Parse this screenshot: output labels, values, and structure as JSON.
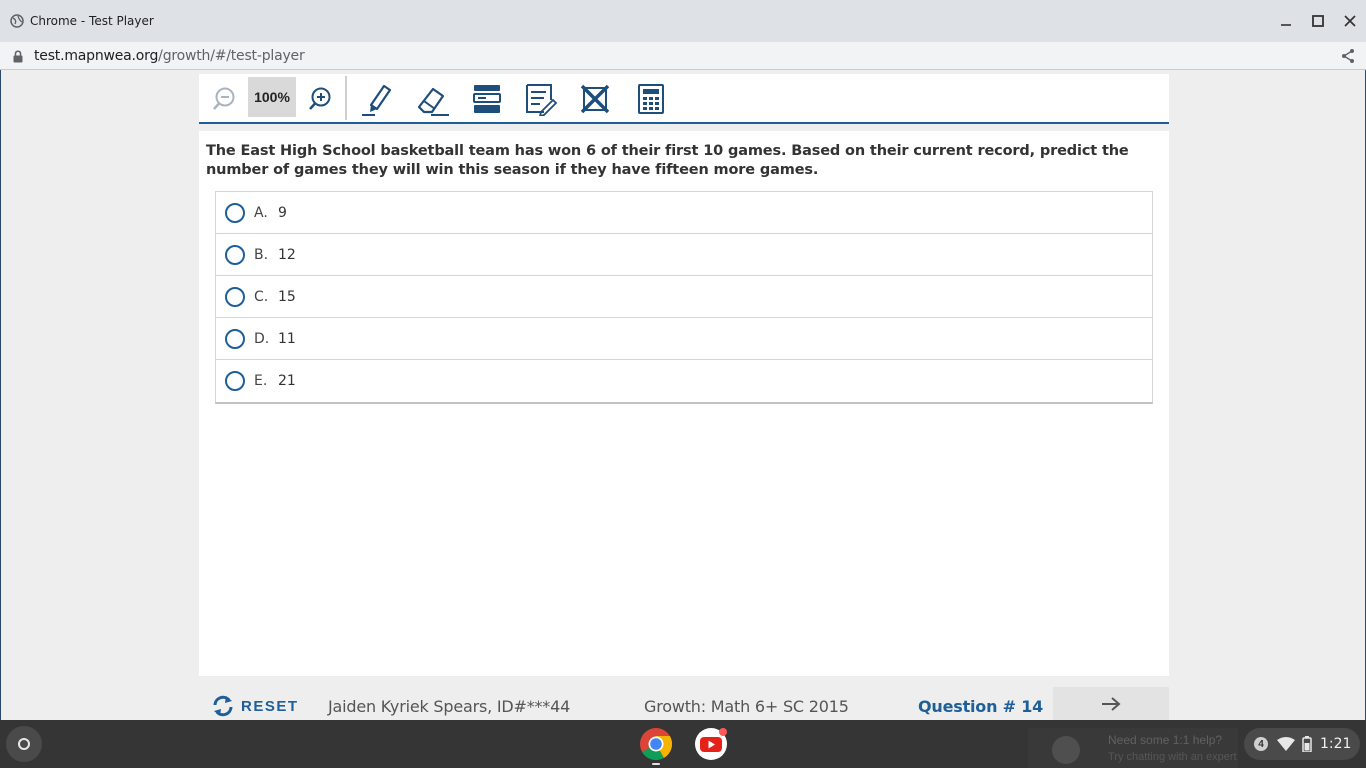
{
  "window": {
    "title": "Chrome - Test Player",
    "url_host": "test.mapnwea.org",
    "url_path": "/growth/#/test-player"
  },
  "toolbar": {
    "zoom_level": "100%",
    "tools": [
      "zoom-out-icon",
      "zoom-in-icon",
      "pen-icon",
      "eraser-icon",
      "line-reader-icon",
      "notepad-icon",
      "answer-eliminator-icon",
      "calculator-icon"
    ]
  },
  "question": {
    "stem": "The East High School basketball team has won 6 of their first 10 games. Based on their current record, predict the number of games they will win this season if they have fifteen more games.",
    "choices": [
      {
        "letter": "A.",
        "value": "9"
      },
      {
        "letter": "B.",
        "value": "12"
      },
      {
        "letter": "C.",
        "value": "15"
      },
      {
        "letter": "D.",
        "value": "11"
      },
      {
        "letter": "E.",
        "value": "21"
      }
    ]
  },
  "footer": {
    "reset_label": "RESET",
    "student": "Jaiden Kyriek Spears, ID#***44",
    "test_name": "Growth: Math 6+ SC 2015",
    "question_number": "Question # 14"
  },
  "shelf": {
    "notification_title": "Need some 1:1 help?",
    "notification_text": "Try chatting with an expert",
    "tray_badge": "4",
    "time": "1:21"
  },
  "colors": {
    "accent": "#1e5f99",
    "shelf": "#353535"
  }
}
